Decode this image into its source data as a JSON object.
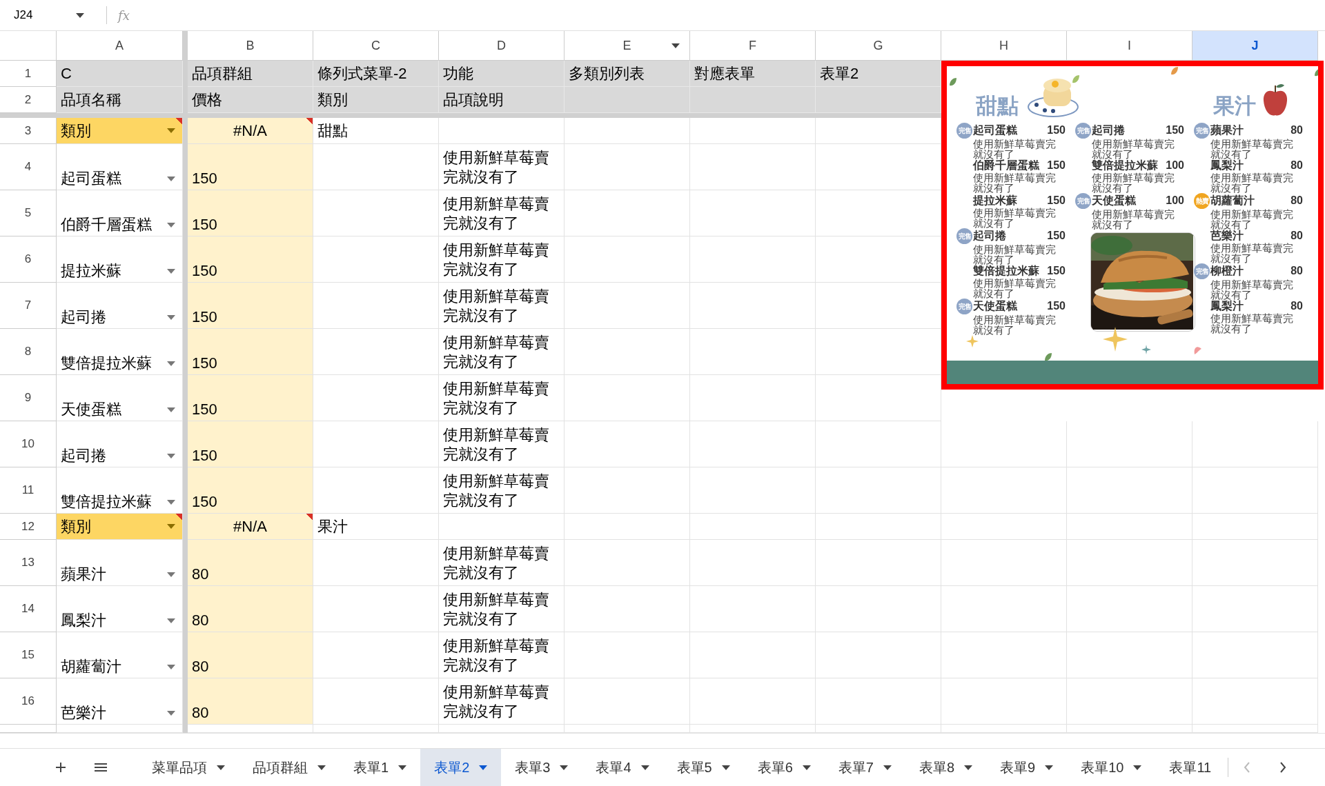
{
  "name_box": {
    "value": "J24"
  },
  "formula_icon": "fx",
  "columns": [
    {
      "label": "A",
      "selected": false,
      "filter": false
    },
    {
      "label": "B",
      "selected": false,
      "filter": false
    },
    {
      "label": "C",
      "selected": false,
      "filter": false
    },
    {
      "label": "D",
      "selected": false,
      "filter": false
    },
    {
      "label": "E",
      "selected": false,
      "filter": true
    },
    {
      "label": "F",
      "selected": false,
      "filter": false
    },
    {
      "label": "G",
      "selected": false,
      "filter": false
    },
    {
      "label": "H",
      "selected": false,
      "filter": false
    },
    {
      "label": "I",
      "selected": false,
      "filter": false
    },
    {
      "label": "J",
      "selected": true,
      "filter": false
    }
  ],
  "rows": [
    {
      "number": "1",
      "kind": "header",
      "cells": {
        "a": "C",
        "b": "品項群組",
        "c": "條列式菜單-2",
        "d": "功能",
        "e": "多類別列表",
        "f": "對應表單",
        "g": "表單2"
      }
    },
    {
      "number": "2",
      "kind": "header",
      "cells": {
        "a": "品項名稱",
        "b": "價格",
        "c": "類別",
        "d": "品項說明"
      }
    },
    {
      "number": "3",
      "kind": "category",
      "cells": {
        "a": "類別",
        "b": "#N/A",
        "c": "甜點"
      }
    },
    {
      "number": "4",
      "kind": "item",
      "cells": {
        "a": "起司蛋糕",
        "b": "150",
        "d": "使用新鮮草莓賣完就沒有了"
      }
    },
    {
      "number": "5",
      "kind": "item",
      "cells": {
        "a": "伯爵千層蛋糕",
        "b": "150",
        "d": "使用新鮮草莓賣完就沒有了"
      }
    },
    {
      "number": "6",
      "kind": "item",
      "cells": {
        "a": "提拉米蘇",
        "b": "150",
        "d": "使用新鮮草莓賣完就沒有了"
      }
    },
    {
      "number": "7",
      "kind": "item",
      "cells": {
        "a": "起司捲",
        "b": "150",
        "d": "使用新鮮草莓賣完就沒有了"
      }
    },
    {
      "number": "8",
      "kind": "item",
      "cells": {
        "a": "雙倍提拉米蘇",
        "b": "150",
        "d": "使用新鮮草莓賣完就沒有了"
      }
    },
    {
      "number": "9",
      "kind": "item",
      "cells": {
        "a": "天使蛋糕",
        "b": "150",
        "d": "使用新鮮草莓賣完就沒有了"
      }
    },
    {
      "number": "10",
      "kind": "item",
      "cells": {
        "a": "起司捲",
        "b": "150",
        "d": "使用新鮮草莓賣完就沒有了"
      }
    },
    {
      "number": "11",
      "kind": "item",
      "cells": {
        "a": "雙倍提拉米蘇",
        "b": "150",
        "d": "使用新鮮草莓賣完就沒有了"
      }
    },
    {
      "number": "12",
      "kind": "category",
      "cells": {
        "a": "類別",
        "b": "#N/A",
        "c": "果汁"
      }
    },
    {
      "number": "13",
      "kind": "item",
      "cells": {
        "a": "蘋果汁",
        "b": "80",
        "d": "使用新鮮草莓賣完就沒有了"
      }
    },
    {
      "number": "14",
      "kind": "item",
      "cells": {
        "a": "鳳梨汁",
        "b": "80",
        "d": "使用新鮮草莓賣完就沒有了"
      }
    },
    {
      "number": "15",
      "kind": "item",
      "cells": {
        "a": "胡蘿蔔汁",
        "b": "80",
        "d": "使用新鮮草莓賣完就沒有了"
      }
    },
    {
      "number": "16",
      "kind": "item",
      "cells": {
        "a": "芭樂汁",
        "b": "80",
        "d": "使用新鮮草莓賣完就沒有了"
      }
    }
  ],
  "menu": {
    "dessert_heading": "甜點",
    "juice_heading": "果汁",
    "columns": [
      {
        "items": [
          {
            "name": "起司蛋糕",
            "price": "150",
            "description": "使用新鮮草莓賣完就沒有了",
            "badge": {
              "text": "完售",
              "kind": "sold-out"
            }
          },
          {
            "name": "伯爵千層蛋糕",
            "price": "150",
            "description": "使用新鮮草莓賣完就沒有了"
          },
          {
            "name": "提拉米蘇",
            "price": "150",
            "description": "使用新鮮草莓賣完就沒有了"
          },
          {
            "name": "起司捲",
            "price": "150",
            "description": "使用新鮮草莓賣完就沒有了",
            "badge": {
              "text": "完售",
              "kind": "sold-out"
            }
          },
          {
            "name": "雙倍提拉米蘇",
            "price": "150",
            "description": "使用新鮮草莓賣完就沒有了"
          },
          {
            "name": "天使蛋糕",
            "price": "150",
            "description": "使用新鮮草莓賣完就沒有了",
            "badge": {
              "text": "完售",
              "kind": "sold-out"
            }
          }
        ]
      },
      {
        "items": [
          {
            "name": "起司捲",
            "price": "150",
            "description": "使用新鮮草莓賣完就沒有了",
            "badge": {
              "text": "完售",
              "kind": "sold-out"
            }
          },
          {
            "name": "雙倍提拉米蘇",
            "price": "100",
            "description": "使用新鮮草莓賣完就沒有了"
          },
          {
            "name": "天使蛋糕",
            "price": "100",
            "description": "使用新鮮草莓賣完就沒有了",
            "badge": {
              "text": "完售",
              "kind": "sold-out"
            }
          }
        ]
      },
      {
        "items": [
          {
            "name": "蘋果汁",
            "price": "80",
            "description": "使用新鮮草莓賣完就沒有了",
            "badge": {
              "text": "完售",
              "kind": "sold-out"
            }
          },
          {
            "name": "鳳梨汁",
            "price": "80",
            "description": "使用新鮮草莓賣完就沒有了"
          },
          {
            "name": "胡蘿蔔汁",
            "price": "80",
            "description": "使用新鮮草莓賣完就沒有了",
            "badge": {
              "text": "熱賣",
              "kind": "hot"
            }
          },
          {
            "name": "芭樂汁",
            "price": "80",
            "description": "使用新鮮草莓賣完就沒有了"
          },
          {
            "name": "柳橙汁",
            "price": "80",
            "description": "使用新鮮草莓賣完就沒有了",
            "badge": {
              "text": "完售",
              "kind": "sold-out"
            }
          },
          {
            "name": "鳳梨汁",
            "price": "80",
            "description": "使用新鮮草莓賣完就沒有了"
          }
        ]
      }
    ]
  },
  "sheet_tabs": [
    {
      "label": "菜單品項",
      "selected": false
    },
    {
      "label": "品項群組",
      "selected": false
    },
    {
      "label": "表單1",
      "selected": false
    },
    {
      "label": "表單2",
      "selected": true
    },
    {
      "label": "表單3",
      "selected": false
    },
    {
      "label": "表單4",
      "selected": false
    },
    {
      "label": "表單5",
      "selected": false
    },
    {
      "label": "表單6",
      "selected": false
    },
    {
      "label": "表單7",
      "selected": false
    },
    {
      "label": "表單8",
      "selected": false
    },
    {
      "label": "表單9",
      "selected": false
    },
    {
      "label": "表單10",
      "selected": false
    },
    {
      "label": "表單11",
      "selected": false
    }
  ]
}
